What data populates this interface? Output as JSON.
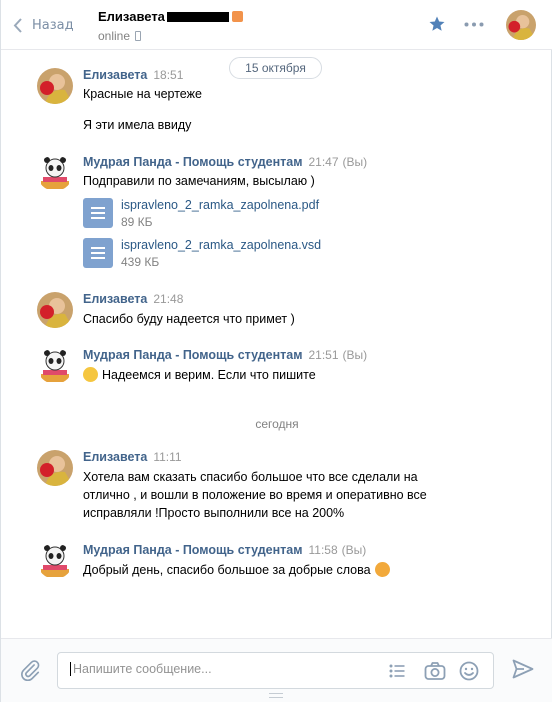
{
  "header": {
    "back_label": "Назад",
    "peer_name": "Елизавета",
    "peer_status": "online"
  },
  "dates": {
    "first": "15 октября",
    "today": "сегодня"
  },
  "messages": [
    {
      "author": "Елизавета",
      "time": "18:51",
      "lines": [
        "Красные на чертеже",
        "Я эти имела ввиду"
      ]
    },
    {
      "author": "Мудрая Панда - Помощь студентам",
      "time": "21:47",
      "you": "(Вы)",
      "lines": [
        "Подправили по замечаниям, высылаю )"
      ],
      "files": [
        {
          "name": "ispravleno_2_ramka_zapolnena.pdf",
          "size": "89 КБ"
        },
        {
          "name": "ispravleno_2_ramka_zapolnena.vsd",
          "size": "439 КБ"
        }
      ]
    },
    {
      "author": "Елизавета",
      "time": "21:48",
      "lines": [
        "Спасибо буду надеется что примет )"
      ]
    },
    {
      "author": "Мудрая Панда - Помощь студентам",
      "time": "21:51",
      "you": "(Вы)",
      "lines": [
        "Надеемся и верим. Если что пишите"
      ]
    },
    {
      "author": "Елизавета",
      "time": "11:11",
      "lines": [
        "Хотела вам сказать спасибо большое что все сделали на",
        "отлично , и вошли в положение во время и оперативно все",
        "исправляли !Просто выполнили все на 200%"
      ]
    },
    {
      "author": "Мудрая Панда - Помощь студентам",
      "time": "11:58",
      "you": "(Вы)",
      "lines": [
        "Добрый день, спасибо большое за добрые слова"
      ]
    }
  ],
  "composer": {
    "placeholder": "Напишите сообщение..."
  },
  "colors": {
    "link": "#42648b",
    "accent": "#5181b8",
    "file_icon": "#7fa2cf"
  },
  "icons": {
    "back": "chevron-left-icon",
    "favorite": "star-icon",
    "more": "more-dots-icon",
    "attach": "paperclip-icon",
    "template": "list-icon",
    "camera": "camera-icon",
    "emoji": "smile-icon",
    "send": "send-icon",
    "document": "document-icon"
  }
}
